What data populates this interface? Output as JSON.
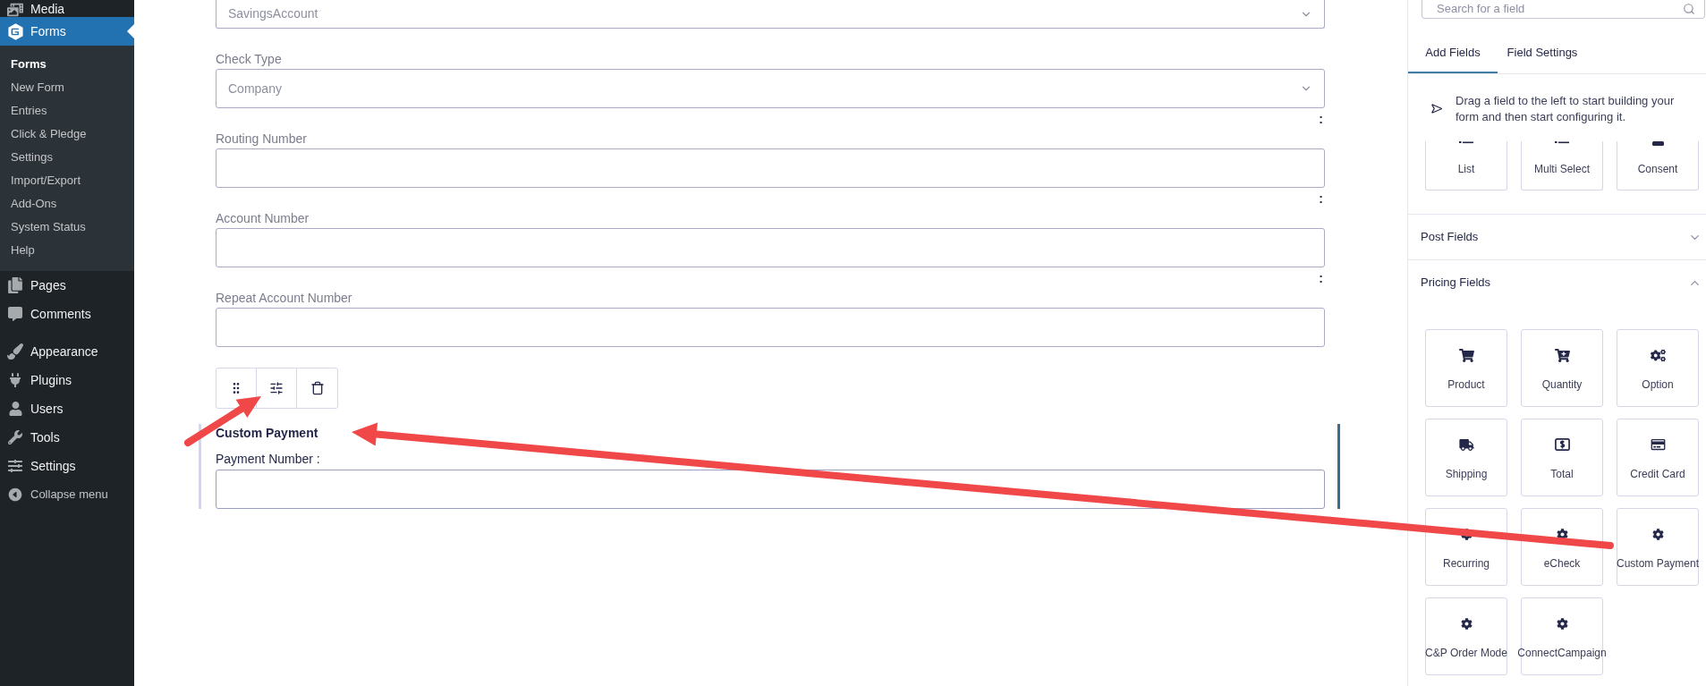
{
  "admin_menu": {
    "groups": [
      [
        {
          "label": "Media",
          "selected": false
        },
        {
          "label": "Forms",
          "selected": true,
          "children": [
            {
              "label": "Forms",
              "selected": true
            },
            {
              "label": "New Form",
              "selected": false
            },
            {
              "label": "Entries",
              "selected": false
            },
            {
              "label": "Click & Pledge",
              "selected": false
            },
            {
              "label": "Settings",
              "selected": false
            },
            {
              "label": "Import/Export",
              "selected": false
            },
            {
              "label": "Add-Ons",
              "selected": false
            },
            {
              "label": "System Status",
              "selected": false
            },
            {
              "label": "Help",
              "selected": false
            }
          ]
        },
        {
          "label": "Pages",
          "selected": false
        },
        {
          "label": "Comments",
          "selected": false
        }
      ],
      [
        {
          "label": "Appearance",
          "selected": false
        },
        {
          "label": "Plugins",
          "selected": false
        },
        {
          "label": "Users",
          "selected": false
        },
        {
          "label": "Tools",
          "selected": false
        },
        {
          "label": "Settings",
          "selected": false
        }
      ]
    ],
    "collapse_label": "Collapse menu"
  },
  "form": {
    "fields": [
      {
        "kind": "select",
        "value": "SavingsAccount"
      },
      {
        "kind": "select",
        "label": "Check Type",
        "value": "Company",
        "trailing_text": ":"
      },
      {
        "kind": "text",
        "label": "Routing Number",
        "trailing_text": ":"
      },
      {
        "kind": "text",
        "label": "Account Number",
        "trailing_text": ":"
      },
      {
        "kind": "text",
        "label": "Repeat Account Number"
      }
    ],
    "selected_field": {
      "title": "Custom Payment",
      "label": "Payment Number :"
    }
  },
  "field_panel": {
    "search": {
      "placeholder": "Search for a field"
    },
    "tabs": [
      {
        "label": "Add Fields",
        "selected": true
      },
      {
        "label": "Field Settings",
        "selected": false
      }
    ],
    "hint": "Drag a field to the left to start building your form and then start configuring it.",
    "scrolled_fields": [
      {
        "label": "List"
      },
      {
        "label": "Multi Select"
      },
      {
        "label": "Consent"
      }
    ],
    "sections": [
      {
        "title": "Post Fields",
        "expanded": false
      },
      {
        "title": "Pricing Fields",
        "expanded": true,
        "fields": [
          {
            "label": "Product"
          },
          {
            "label": "Quantity"
          },
          {
            "label": "Option"
          },
          {
            "label": "Shipping"
          },
          {
            "label": "Total"
          },
          {
            "label": "Credit Card"
          },
          {
            "label": "Recurring"
          },
          {
            "label": "eCheck"
          },
          {
            "label": "Custom Payment"
          },
          {
            "label": "C&P Order Mode"
          },
          {
            "label": "ConnectCampaign"
          }
        ]
      }
    ]
  }
}
